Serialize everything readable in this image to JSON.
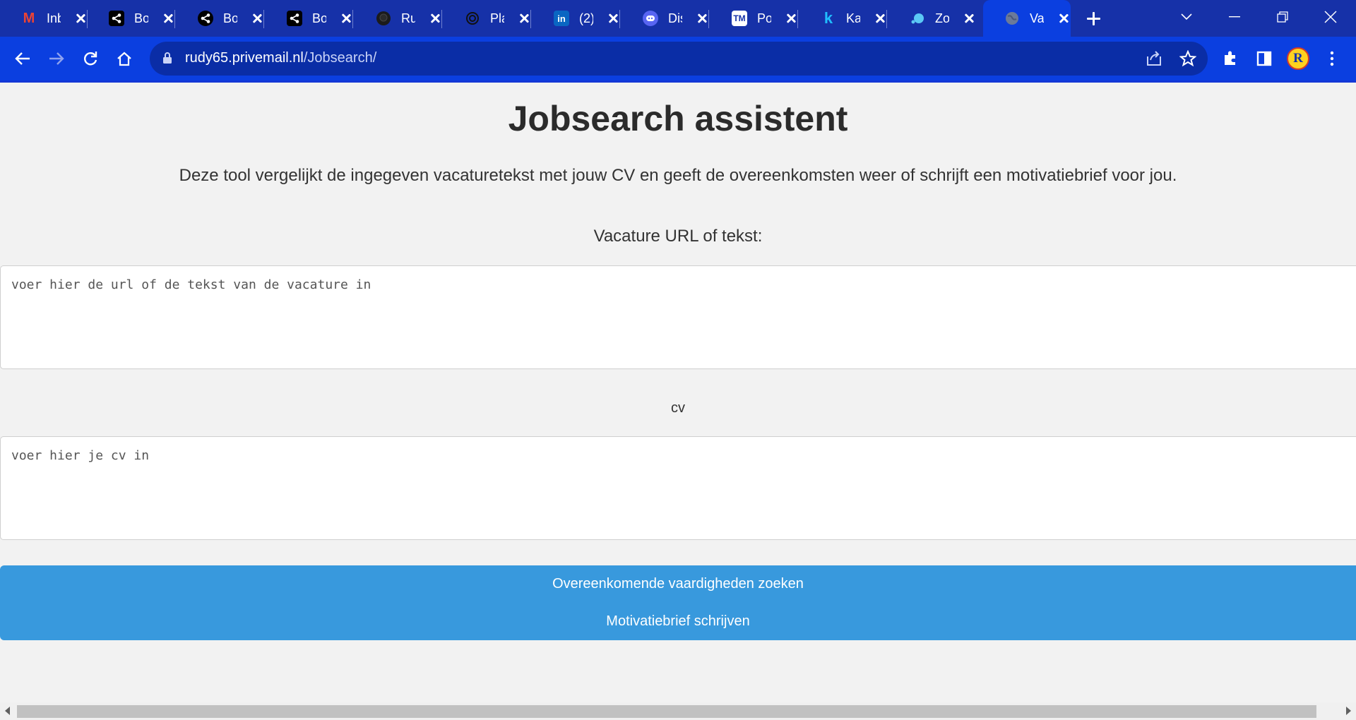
{
  "browser": {
    "tabs": [
      {
        "title": "Inbox",
        "favicon": "gmail-icon",
        "fav_bg": "transparent",
        "fav_text": "M"
      },
      {
        "title": "Bot",
        "favicon": "share-icon",
        "fav_bg": "#000000",
        "fav_text": "<"
      },
      {
        "title": "Bot",
        "favicon": "share-icon",
        "fav_bg": "#000000",
        "fav_text": "<"
      },
      {
        "title": "Bot",
        "favicon": "share-icon",
        "fav_bg": "#000000",
        "fav_text": "<"
      },
      {
        "title": "Rud",
        "favicon": "github-icon",
        "fav_bg": "#1b1b1b",
        "fav_text": "●"
      },
      {
        "title": "Play",
        "favicon": "openai-icon",
        "fav_bg": "transparent",
        "fav_text": "✿"
      },
      {
        "title": "(2)",
        "favicon": "linkedin-icon",
        "fav_bg": "#0a66c2",
        "fav_text": "in"
      },
      {
        "title": "Dis",
        "favicon": "discord-icon",
        "fav_bg": "#5865f2",
        "fav_text": "◉"
      },
      {
        "title": "Po",
        "favicon": "tm-icon",
        "fav_bg": "#ffffff",
        "fav_text": "TM"
      },
      {
        "title": "Kag",
        "favicon": "kaggle-icon",
        "fav_bg": "transparent",
        "fav_text": "k"
      },
      {
        "title": "Zo",
        "favicon": "zoho-icon",
        "fav_bg": "transparent",
        "fav_text": "●"
      },
      {
        "title": "Vac",
        "favicon": "globe-icon",
        "fav_bg": "transparent",
        "fav_text": "◍",
        "active": true
      }
    ],
    "url_host": "rudy65.privemail.nl",
    "url_path": "/Jobsearch/",
    "profile_initials": "R"
  },
  "page": {
    "title": "Jobsearch assistent",
    "intro": "Deze tool vergelijkt de ingegeven vacaturetekst met jouw CV en geeft de overeenkomsten weer of schrijft een motivatiebrief voor jou.",
    "vacature_label": "Vacature URL of tekst:",
    "vacature_placeholder": "voer hier de url of de tekst van de vacature in",
    "cv_label": "cv",
    "cv_placeholder": "voer hier je cv in",
    "match_button": "Overeenkomende vaardigheden zoeken",
    "letter_button": "Motivatiebrief schrijven"
  },
  "colors": {
    "tabstrip": "#1631a8",
    "toolbar": "#0b3fe0",
    "button": "#3899dd",
    "page_bg": "#f2f2f2"
  }
}
